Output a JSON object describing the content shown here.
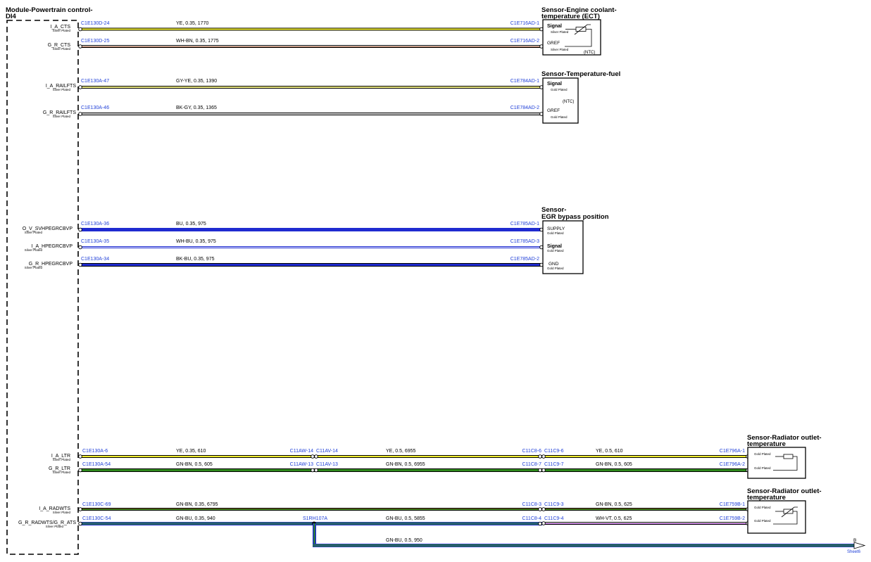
{
  "module": {
    "title_line1": "Module-Powertrain control-",
    "title_line2": "DI4",
    "pins": [
      {
        "name": "I_A_CTS",
        "plating": "Silver Plated"
      },
      {
        "name": "G_R_CTS",
        "plating": "Silver Plated"
      },
      {
        "name": "I_A_RAILFTS",
        "plating": "Silver Plated"
      },
      {
        "name": "G_R_RAILFTS",
        "plating": "Silver Plated"
      },
      {
        "name": "O_V_SVHPEGRCBVP",
        "plating": "Silver Plated"
      },
      {
        "name": "I_A_HPEGRCBVP",
        "plating": "Silver Plated"
      },
      {
        "name": "G_R_HPEGRCBVP",
        "plating": "Silver Plated"
      },
      {
        "name": "I_A_LTR",
        "plating": "Silver Plated"
      },
      {
        "name": "G_R_LTR",
        "plating": "Silver Plated"
      },
      {
        "name": "I_A_RADWTS",
        "plating": "Silver Plated"
      },
      {
        "name": "G_R_RADWTS/G_R_ATS",
        "plating": "Silver Plated"
      }
    ]
  },
  "wires": [
    {
      "from": "C1E130D-24",
      "spec": "YE, 0.35, 1770",
      "to": "C1E716AD-1",
      "color": "#f2ee30"
    },
    {
      "from": "C1E130D-25",
      "spec": "WH-BN, 0.35, 1775",
      "to": "C1E716AD-2",
      "color": "#a0522d"
    },
    {
      "from": "C1E130A-47",
      "spec": "GY-YE, 0.35, 1390",
      "to": "C1E784AD-1",
      "color": "#e8e680"
    },
    {
      "from": "C1E130A-46",
      "spec": "BK-GY, 0.35, 1365",
      "to": "C1E784AD-2",
      "color": "#bdbdbd"
    },
    {
      "from": "C1E130A-36",
      "spec": "BU, 0.35, 975",
      "to": "C1E785AD-1",
      "color": "#1f2bd0"
    },
    {
      "from": "C1E130A-35",
      "spec": "WH-BU, 0.35, 975",
      "to": "C1E785AD-3",
      "color": "#1f2bd0"
    },
    {
      "from": "C1E130A-34",
      "spec": "BK-BU, 0.35, 975",
      "to": "C1E785AD-2",
      "color": "#1f2bd0"
    }
  ],
  "ltr_wires": [
    {
      "from": "C1E130A-6",
      "spec1": "YE, 0.35, 610",
      "mid1a": "C11AW-14",
      "mid1b": "C11AV-14",
      "spec2": "YE, 0.5, 6955",
      "mid2a": "C11C8-6",
      "mid2b": "C11C9-6",
      "spec3": "YE, 0.5, 610",
      "to": "C1E796A-1"
    },
    {
      "from": "C1E130A-54",
      "spec1": "GN-BN, 0.5, 605",
      "mid1a": "C11AW-13",
      "mid1b": "C11AV-13",
      "spec2": "GN-BN, 0.5, 6955",
      "mid2a": "C11C8-7",
      "mid2b": "C11C9-7",
      "spec3": "GN-BN, 0.5, 605",
      "to": "C1E796A-2"
    }
  ],
  "rad_wires": [
    {
      "from": "C1E130C-69",
      "spec1": "GN-BN, 0.35, 6795",
      "mid2a": "C11C8-3",
      "mid2b": "C11C9-3",
      "spec3": "GN-BN, 0.5, 625",
      "to": "C1E759B-1"
    },
    {
      "from": "C1E130C-54",
      "spec1": "GN-BU, 0.35, 940",
      "splice": "S1RH107A",
      "spec2": "GN-BU, 0.5, 5855",
      "mid2a": "C11C8-4",
      "mid2b": "C11C9-4",
      "spec3": "WH-VT, 0.5, 625",
      "to": "C1E759B-2"
    }
  ],
  "branch": {
    "spec": "GN-BU, 0.5, 950",
    "ref": "B",
    "sheet": "Sheet6"
  },
  "components": {
    "ect": {
      "title_line1": "Sensor-Engine coolant-",
      "title_line2": "temperature (ECT)",
      "pin1": "Signal",
      "pin1_plating": "Silver Plated",
      "pin2": "GREF",
      "pin2_plating": "Silver Plated",
      "note": "(NTC)"
    },
    "fuel": {
      "title": "Sensor-Temperature-fuel",
      "pin1": "Signal",
      "pin1_plating": "Gold Plated",
      "note": "(NTC)",
      "pin2": "GREF",
      "pin2_plating": "Gold Plated"
    },
    "egr": {
      "title_line1": "Sensor-",
      "title_line2": "EGR bypass position",
      "pin1": "SUPPLY",
      "pin1_plating": "Gold Plated",
      "pin2": "Signal",
      "pin2_plating": "Gold Plated",
      "pin3": "GND",
      "pin3_plating": "Gold Plated"
    },
    "rad1": {
      "title_line1": "Sensor-Radiator outlet-",
      "title_line2": "temperature",
      "pin1_plating": "Gold Plated",
      "pin2_plating": "Gold Plated"
    },
    "rad2": {
      "title_line1": "Sensor-Radiator outlet-",
      "title_line2": "temperature",
      "pin1_plating": "Gold Plated",
      "pin2_plating": "Gold Plated"
    }
  }
}
